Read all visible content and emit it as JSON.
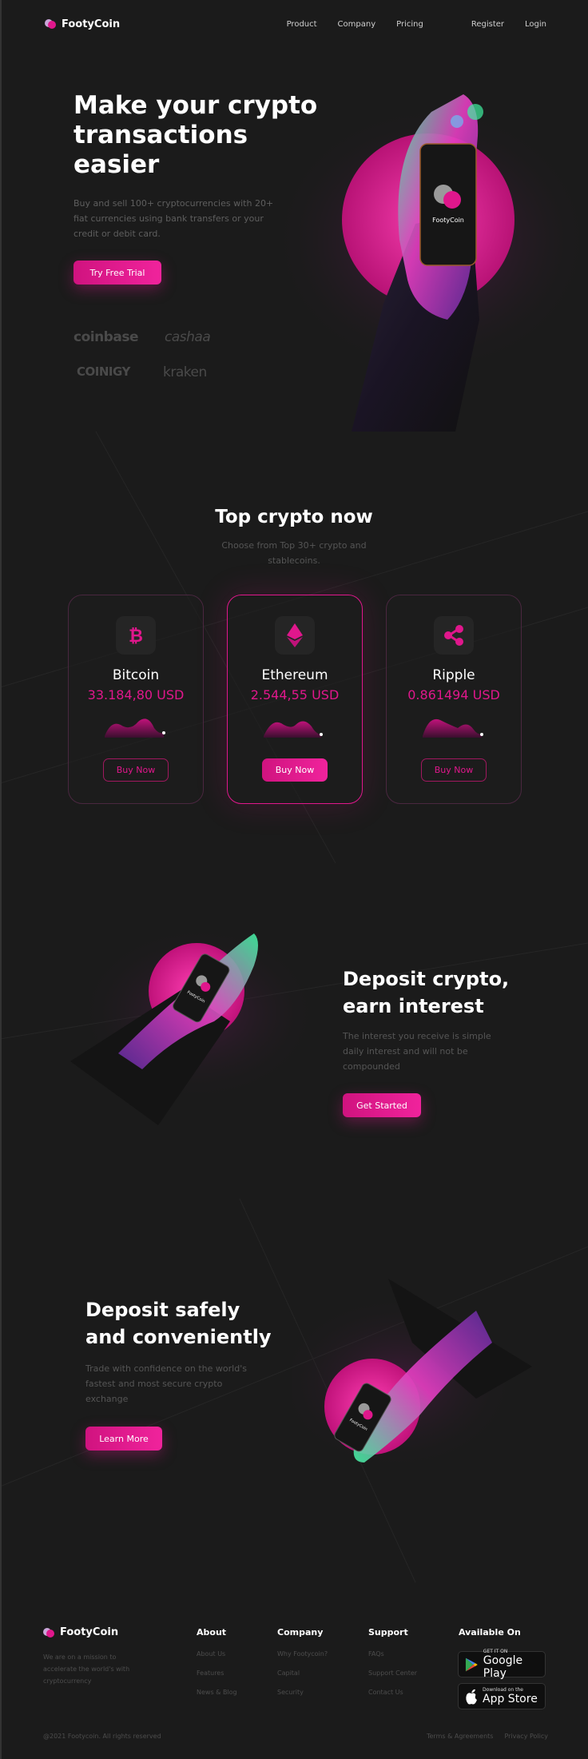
{
  "brand": {
    "name": "FootyCoin",
    "accent": "#e0178c"
  },
  "nav": {
    "links": [
      "Product",
      "Company",
      "Pricing"
    ],
    "auth": [
      "Register",
      "Login"
    ]
  },
  "hero": {
    "title": "Make your crypto transactions easier",
    "subtitle": "Buy and sell 100+ cryptocurrencies with 20+ fiat currencies using bank transfers or your credit or debit card.",
    "cta": "Try Free Trial",
    "phone_label": "FootyCoin",
    "partners": [
      "coinbase",
      "cashaa",
      "COINIGY",
      "kraken"
    ]
  },
  "top_crypto": {
    "title": "Top crypto now",
    "subtitle": "Choose from Top 30+ crypto and stablecoins.",
    "cards": [
      {
        "name": "Bitcoin",
        "price": "33.184,80 USD",
        "icon": "bitcoin-icon",
        "button": "Buy Now"
      },
      {
        "name": "Ethereum",
        "price": "2.544,55 USD",
        "icon": "ethereum-icon",
        "button": "Buy Now"
      },
      {
        "name": "Ripple",
        "price": "0.861494 USD",
        "icon": "ripple-icon",
        "button": "Buy Now"
      }
    ]
  },
  "feature1": {
    "title": "Deposit crypto, earn interest",
    "subtitle": "The interest you receive is simple daily interest and will not be compounded",
    "cta": "Get Started",
    "phone_label": "FootyCoin"
  },
  "feature2": {
    "title": "Deposit safely and conveniently",
    "subtitle": "Trade with confidence on the world's fastest and most secure crypto exchange",
    "cta": "Learn More",
    "phone_label": "FootyCoin"
  },
  "footer": {
    "tagline": "We are on a mission to accelerate the world's with cryptocurrency",
    "columns": [
      {
        "title": "About",
        "items": [
          "About Us",
          "Features",
          "News & Blog"
        ]
      },
      {
        "title": "Company",
        "items": [
          "Why Footycoin?",
          "Capital",
          "Security"
        ]
      },
      {
        "title": "Support",
        "items": [
          "FAQs",
          "Support Center",
          "Contact Us"
        ]
      }
    ],
    "available_title": "Available On",
    "stores": [
      {
        "small": "GET IT ON",
        "big": "Google Play"
      },
      {
        "small": "Download on the",
        "big": "App Store"
      }
    ],
    "copyright": "@2021 Footycoin. All rights reserved",
    "legal": [
      "Terms & Agreements",
      "Privacy Policy"
    ]
  }
}
